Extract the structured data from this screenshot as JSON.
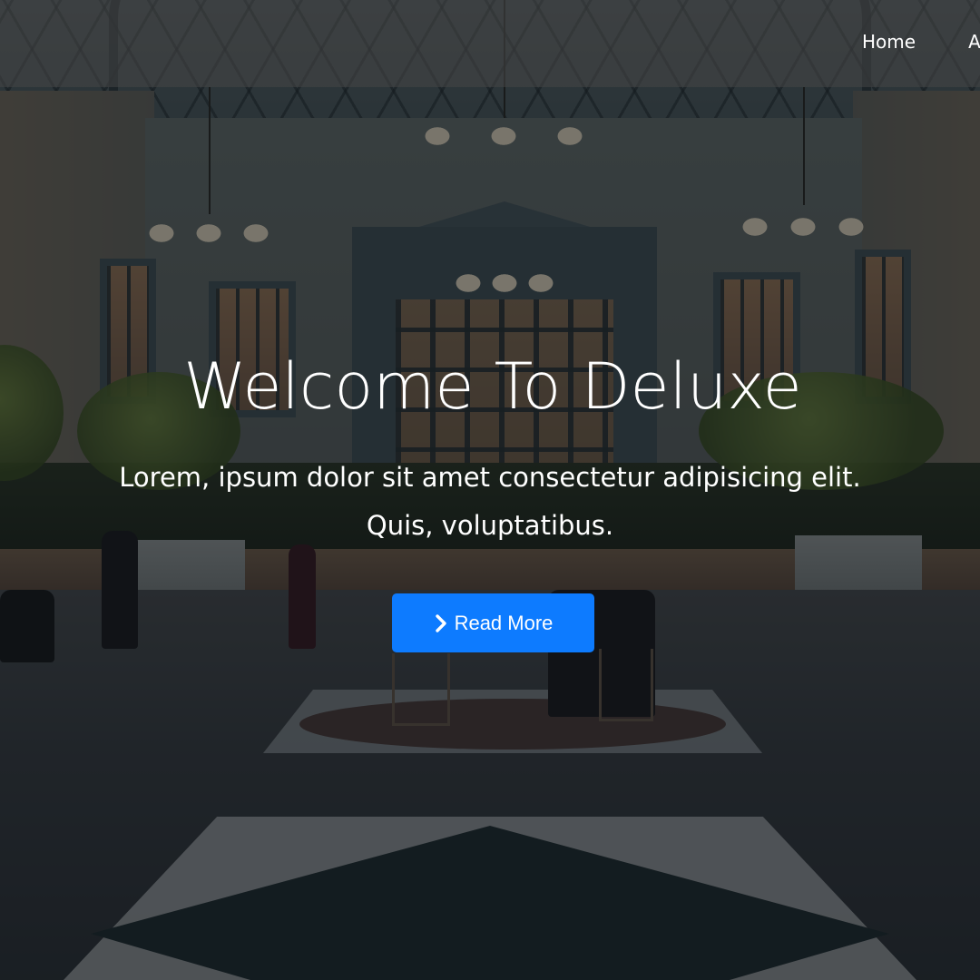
{
  "nav": {
    "items": [
      {
        "label": "Home",
        "name": "nav-home"
      },
      {
        "label": "A"
      }
    ]
  },
  "hero": {
    "title": "Welcome To Deluxe",
    "subtitle_line1": "Lorem, ipsum dolor sit amet consectetur adipisicing elit.",
    "subtitle_line2": "Quis, voluptatibus.",
    "button": {
      "label": "Read More",
      "icon": "chevron-right-icon",
      "color": "#0d7bff"
    }
  },
  "colors": {
    "overlay": "rgba(10,14,18,0.52)",
    "navbar": "rgba(70,70,70,0.55)",
    "text": "#ffffff"
  }
}
